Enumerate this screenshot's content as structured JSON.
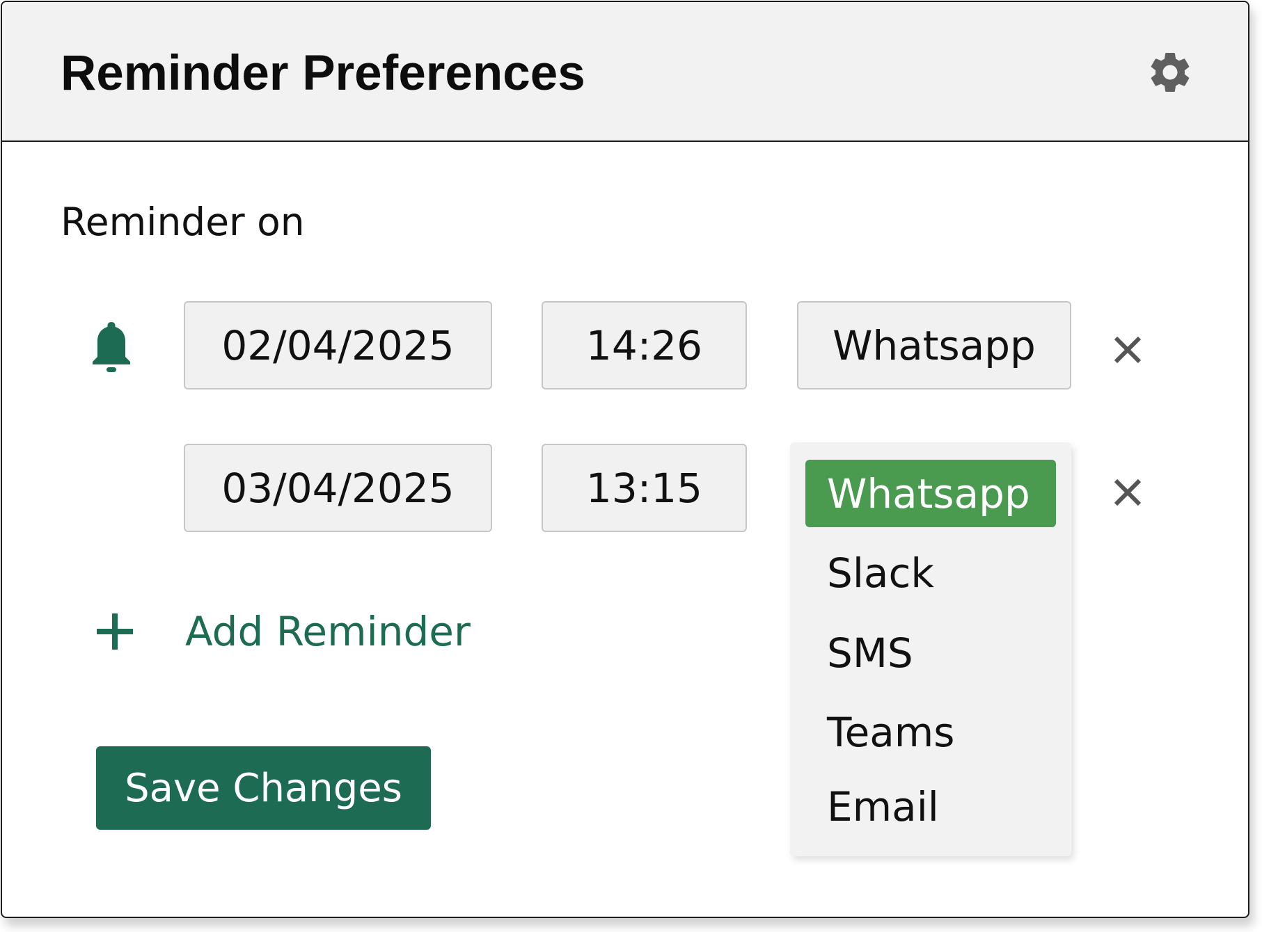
{
  "header": {
    "title": "Reminder Preferences",
    "settings_icon": "gear-icon"
  },
  "section": {
    "label": "Reminder on"
  },
  "reminders": [
    {
      "date": "02/04/2025",
      "time": "14:26",
      "channel": "Whatsapp"
    },
    {
      "date": "03/04/2025",
      "time": "13:15",
      "channel": "Whatsapp"
    }
  ],
  "add_reminder": {
    "label": "Add Reminder"
  },
  "save_button": {
    "label": "Save Changes"
  },
  "channel_dropdown": {
    "options": [
      "Whatsapp",
      "Slack",
      "SMS",
      "Teams",
      "Email"
    ],
    "selected": "Whatsapp"
  },
  "colors": {
    "accent": "#1c6b52",
    "selected_option": "#4a9b4f",
    "header_bg": "#f2f2f2",
    "field_bg": "#f1f1f1"
  },
  "icons": [
    "gear-icon",
    "bell-icon",
    "close-icon",
    "plus-icon"
  ]
}
